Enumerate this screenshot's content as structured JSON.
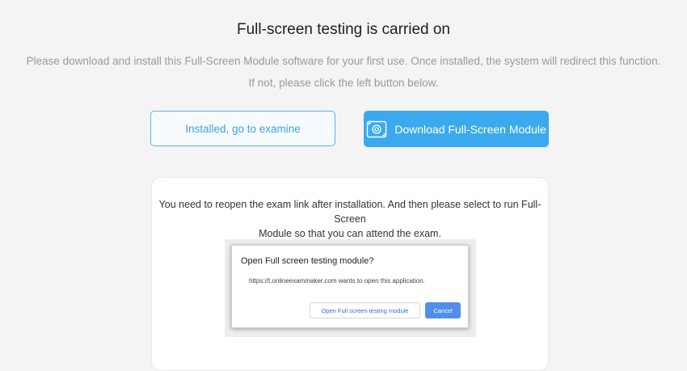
{
  "page": {
    "title": "Full-screen testing is carried on",
    "description_line1": "Please download and install this Full-Screen Module software for your first use. Once installed, the system will redirect this function.",
    "description_line2": "If not, please click the left button below."
  },
  "actions": {
    "installed_label": "Installed, go to examine",
    "download_label": "Download Full-Screen Module",
    "download_icon": "fullscreen-module-icon"
  },
  "card": {
    "instruction_line1": "You need to reopen the exam link after installation. And then please select to run Full-Screen",
    "instruction_line2": "Module so that you can attend the exam."
  },
  "example_dialog": {
    "title": "Open Full screen testing module?",
    "message": "https://t.onlineexammaker.com wants to open this application.",
    "open_label": "Open Full screen testing module",
    "cancel_label": "Cancel"
  },
  "colors": {
    "accent": "#3ba9ee",
    "outline_accent": "#5ab3ea",
    "background": "#f4f4f4",
    "dialog_primary": "#4f8fea"
  }
}
